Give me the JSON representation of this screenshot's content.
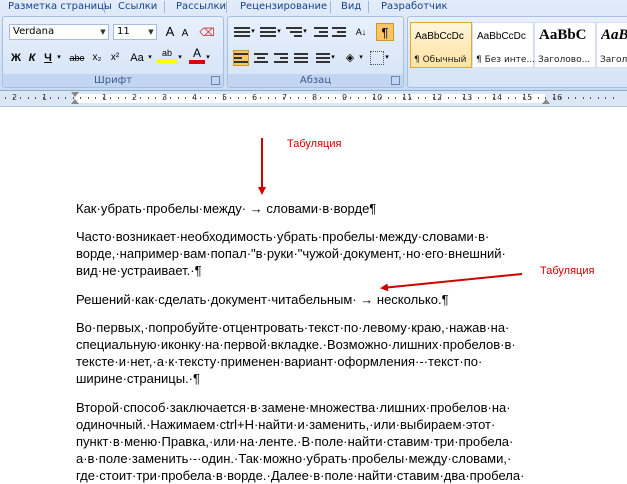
{
  "ribbon": {
    "tabs": [
      "Разметка страницы",
      "Ссылки",
      "Рассылки",
      "Рецензирование",
      "Вид",
      "Разработчик"
    ],
    "font": {
      "group_label": "Шрифт",
      "font_name": "Verdana",
      "font_size": "11",
      "bold": "Ж",
      "italic": "К",
      "underline": "Ч",
      "strike": "abe",
      "subscript": "x₂",
      "superscript": "x²",
      "change_case": "Aa",
      "grow": "A",
      "shrink": "A",
      "highlight": "ab",
      "font_color": "A",
      "highlight_color": "#ffff00",
      "font_color_value": "#e00000"
    },
    "paragraph": {
      "group_label": "Абзац",
      "pilcrow": "¶",
      "sort": "А↓",
      "pilcrow_active_color": "#f8c667"
    },
    "styles": [
      {
        "sample": "AaBbCcDc",
        "name": "¶ Обычный",
        "active": true
      },
      {
        "sample": "AaBbCcDc",
        "name": "¶ Без инте..."
      },
      {
        "sample": "AaBbC",
        "name": "Заголово..."
      },
      {
        "sample": "AaBb",
        "name": "Заголово..."
      }
    ]
  },
  "ruler": {
    "numbers": [
      "3",
      "2",
      "1",
      "1",
      "2",
      "3",
      "4",
      "5",
      "6",
      "7",
      "8",
      "9",
      "10",
      "11",
      "12",
      "13",
      "14",
      "15",
      "16"
    ]
  },
  "annotations": {
    "top_label": "Табуляция",
    "right_label": "Табуляция",
    "color": "#d00000"
  },
  "document": {
    "p1": "Как·убрать·пробелы·между·  →  словами·в·ворде¶",
    "p2": "Часто·возникает·необходимость·убрать·пробелы·между·словами·в·\nворде,·например·вам·попал·\"в·руки·\"чужой·документ,·но·его·внешний·\nвид·не·устраивает.·¶",
    "p3": "Решений·как·сделать·документ·читабельным·  →  несколько.¶",
    "p4": "Во·первых,·попробуйте·отцентровать·текст·по·левому·краю,·нажав·на·\nспециальную·иконку·на·первой·вкладке.·Возможно·лишних·пробелов·в·\nтексте·и·нет,·а·к·тексту·применен·вариант·оформления·-·текст·по·\nширине·страницы.·¶",
    "p5": "Второй·способ·заключается·в·замене·множества·лишних·пробелов·на·\nодиночный.·Нажимаем·ctrl+H·найти·и·заменить,·или·выбираем·этот·\nпункт·в·меню·Правка,·или·на·ленте.·В·поле·найти·ставим·три·пробела·\nа·в·поле·заменить·-·один.·Так·можно·убрать·пробелы·между·словами,·\nгде·стоит·три·пробела·в·ворде.·Далее·в·поле·найти·ставим·два·пробела·"
  }
}
